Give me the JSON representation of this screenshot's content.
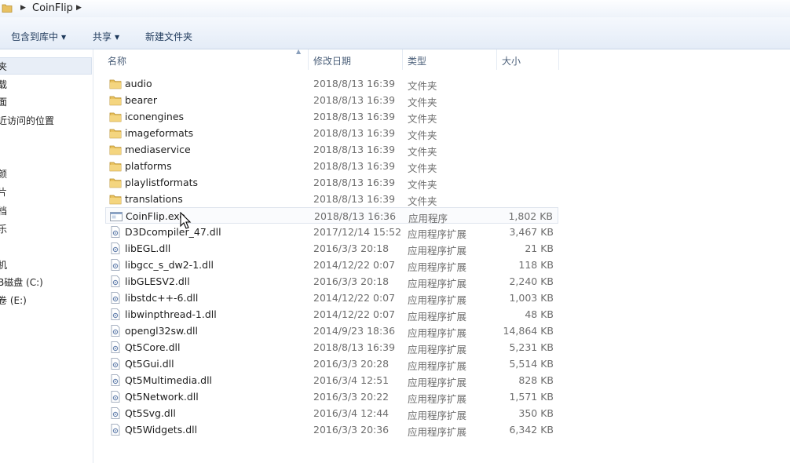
{
  "address": {
    "path": "CoinFlip"
  },
  "toolbar": {
    "include_library": "包含到库中",
    "share": "共享",
    "new_folder": "新建文件夹"
  },
  "nav": {
    "items": [
      "夹",
      "载",
      "面",
      "近访问的位置",
      "颜",
      "片",
      "档",
      "乐",
      "机",
      "B磁盘 (C:)",
      "卷 (E:)"
    ]
  },
  "columns": {
    "name": "名称",
    "date": "修改日期",
    "type": "类型",
    "size": "大小"
  },
  "files": [
    {
      "name": "audio",
      "date": "2018/8/13 16:39",
      "type": "文件夹",
      "size": "",
      "icon": "folder-icon"
    },
    {
      "name": "bearer",
      "date": "2018/8/13 16:39",
      "type": "文件夹",
      "size": "",
      "icon": "folder-icon"
    },
    {
      "name": "iconengines",
      "date": "2018/8/13 16:39",
      "type": "文件夹",
      "size": "",
      "icon": "folder-icon"
    },
    {
      "name": "imageformats",
      "date": "2018/8/13 16:39",
      "type": "文件夹",
      "size": "",
      "icon": "folder-icon"
    },
    {
      "name": "mediaservice",
      "date": "2018/8/13 16:39",
      "type": "文件夹",
      "size": "",
      "icon": "folder-icon"
    },
    {
      "name": "platforms",
      "date": "2018/8/13 16:39",
      "type": "文件夹",
      "size": "",
      "icon": "folder-icon"
    },
    {
      "name": "playlistformats",
      "date": "2018/8/13 16:39",
      "type": "文件夹",
      "size": "",
      "icon": "folder-icon"
    },
    {
      "name": "translations",
      "date": "2018/8/13 16:39",
      "type": "文件夹",
      "size": "",
      "icon": "folder-icon"
    },
    {
      "name": "CoinFlip.exe",
      "date": "2018/8/13 16:36",
      "type": "应用程序",
      "size": "1,802 KB",
      "icon": "exe-icon"
    },
    {
      "name": "D3Dcompiler_47.dll",
      "date": "2017/12/14 15:52",
      "type": "应用程序扩展",
      "size": "3,467 KB",
      "icon": "dll-icon"
    },
    {
      "name": "libEGL.dll",
      "date": "2016/3/3 20:18",
      "type": "应用程序扩展",
      "size": "21 KB",
      "icon": "dll-icon"
    },
    {
      "name": "libgcc_s_dw2-1.dll",
      "date": "2014/12/22 0:07",
      "type": "应用程序扩展",
      "size": "118 KB",
      "icon": "dll-icon"
    },
    {
      "name": "libGLESV2.dll",
      "date": "2016/3/3 20:18",
      "type": "应用程序扩展",
      "size": "2,240 KB",
      "icon": "dll-icon"
    },
    {
      "name": "libstdc++-6.dll",
      "date": "2014/12/22 0:07",
      "type": "应用程序扩展",
      "size": "1,003 KB",
      "icon": "dll-icon"
    },
    {
      "name": "libwinpthread-1.dll",
      "date": "2014/12/22 0:07",
      "type": "应用程序扩展",
      "size": "48 KB",
      "icon": "dll-icon"
    },
    {
      "name": "opengl32sw.dll",
      "date": "2014/9/23 18:36",
      "type": "应用程序扩展",
      "size": "14,864 KB",
      "icon": "dll-icon"
    },
    {
      "name": "Qt5Core.dll",
      "date": "2018/8/13 16:39",
      "type": "应用程序扩展",
      "size": "5,231 KB",
      "icon": "dll-icon"
    },
    {
      "name": "Qt5Gui.dll",
      "date": "2016/3/3 20:28",
      "type": "应用程序扩展",
      "size": "5,514 KB",
      "icon": "dll-icon"
    },
    {
      "name": "Qt5Multimedia.dll",
      "date": "2016/3/4 12:51",
      "type": "应用程序扩展",
      "size": "828 KB",
      "icon": "dll-icon"
    },
    {
      "name": "Qt5Network.dll",
      "date": "2016/3/3 20:22",
      "type": "应用程序扩展",
      "size": "1,571 KB",
      "icon": "dll-icon"
    },
    {
      "name": "Qt5Svg.dll",
      "date": "2016/3/4 12:44",
      "type": "应用程序扩展",
      "size": "350 KB",
      "icon": "dll-icon"
    },
    {
      "name": "Qt5Widgets.dll",
      "date": "2016/3/3 20:36",
      "type": "应用程序扩展",
      "size": "6,342 KB",
      "icon": "dll-icon"
    }
  ],
  "hovered_row": "CoinFlip.exe"
}
